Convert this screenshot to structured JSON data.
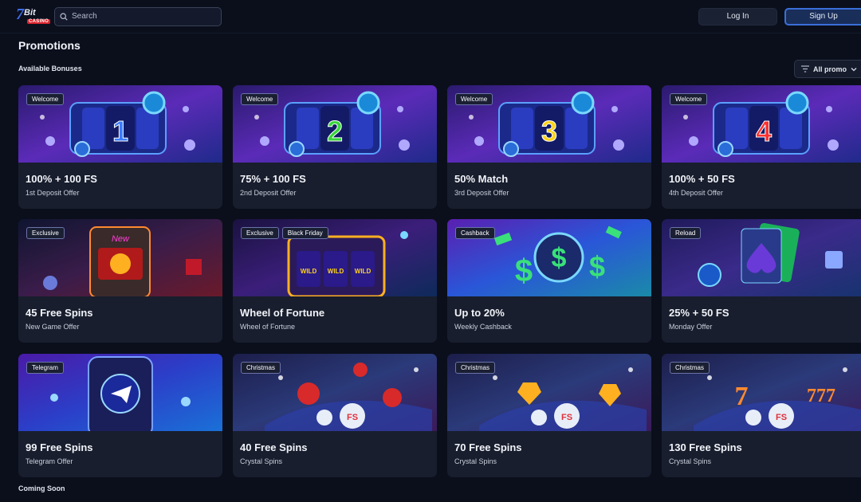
{
  "header": {
    "logo": {
      "number": "7",
      "word": "Bit",
      "badge": "CASINO"
    },
    "search": {
      "placeholder": "Search",
      "value": ""
    },
    "login_label": "Log In",
    "signup_label": "Sign Up",
    "colors": {
      "accent": "#3a6fd8",
      "background": "#0b0f1c",
      "card": "#181e2d"
    }
  },
  "page": {
    "title": "Promotions",
    "section_available": "Available Bonuses",
    "section_coming": "Coming Soon",
    "filter_label": "All promo"
  },
  "cards": [
    {
      "tags": [
        "Welcome"
      ],
      "title": "100% + 100 FS",
      "subtitle": "1st Deposit Offer",
      "art": "slot-1-icon"
    },
    {
      "tags": [
        "Welcome"
      ],
      "title": "75% + 100 FS",
      "subtitle": "2nd Deposit Offer",
      "art": "slot-2-icon"
    },
    {
      "tags": [
        "Welcome"
      ],
      "title": "50% Match",
      "subtitle": "3rd Deposit Offer",
      "art": "slot-3-icon"
    },
    {
      "tags": [
        "Welcome"
      ],
      "title": "100% + 50 FS",
      "subtitle": "4th Deposit Offer",
      "art": "slot-4-icon"
    },
    {
      "tags": [
        "Exclusive"
      ],
      "title": "45 Free Spins",
      "subtitle": "New Game Offer",
      "art": "slot-machine-icon"
    },
    {
      "tags": [
        "Exclusive",
        "Black Friday"
      ],
      "title": "Wheel of Fortune",
      "subtitle": "Wheel of Fortune",
      "art": "wild-slot-icon"
    },
    {
      "tags": [
        "Cashback"
      ],
      "title": "Up to 20%",
      "subtitle": "Weekly Cashback",
      "art": "dollar-icon"
    },
    {
      "tags": [
        "Reload"
      ],
      "title": "25% + 50 FS",
      "subtitle": "Monday Offer",
      "art": "cards-spade-icon"
    },
    {
      "tags": [
        "Telegram"
      ],
      "title": "99 Free Spins",
      "subtitle": "Telegram Offer",
      "art": "telegram-phone-icon"
    },
    {
      "tags": [
        "Christmas"
      ],
      "title": "40 Free Spins",
      "subtitle": "Crystal Spins",
      "art": "apple-fs-icon"
    },
    {
      "tags": [
        "Christmas"
      ],
      "title": "70 Free Spins",
      "subtitle": "Crystal Spins",
      "art": "gem-fs-icon"
    },
    {
      "tags": [
        "Christmas"
      ],
      "title": "130 Free Spins",
      "subtitle": "Crystal Spins",
      "art": "seven-fs-icon"
    }
  ]
}
